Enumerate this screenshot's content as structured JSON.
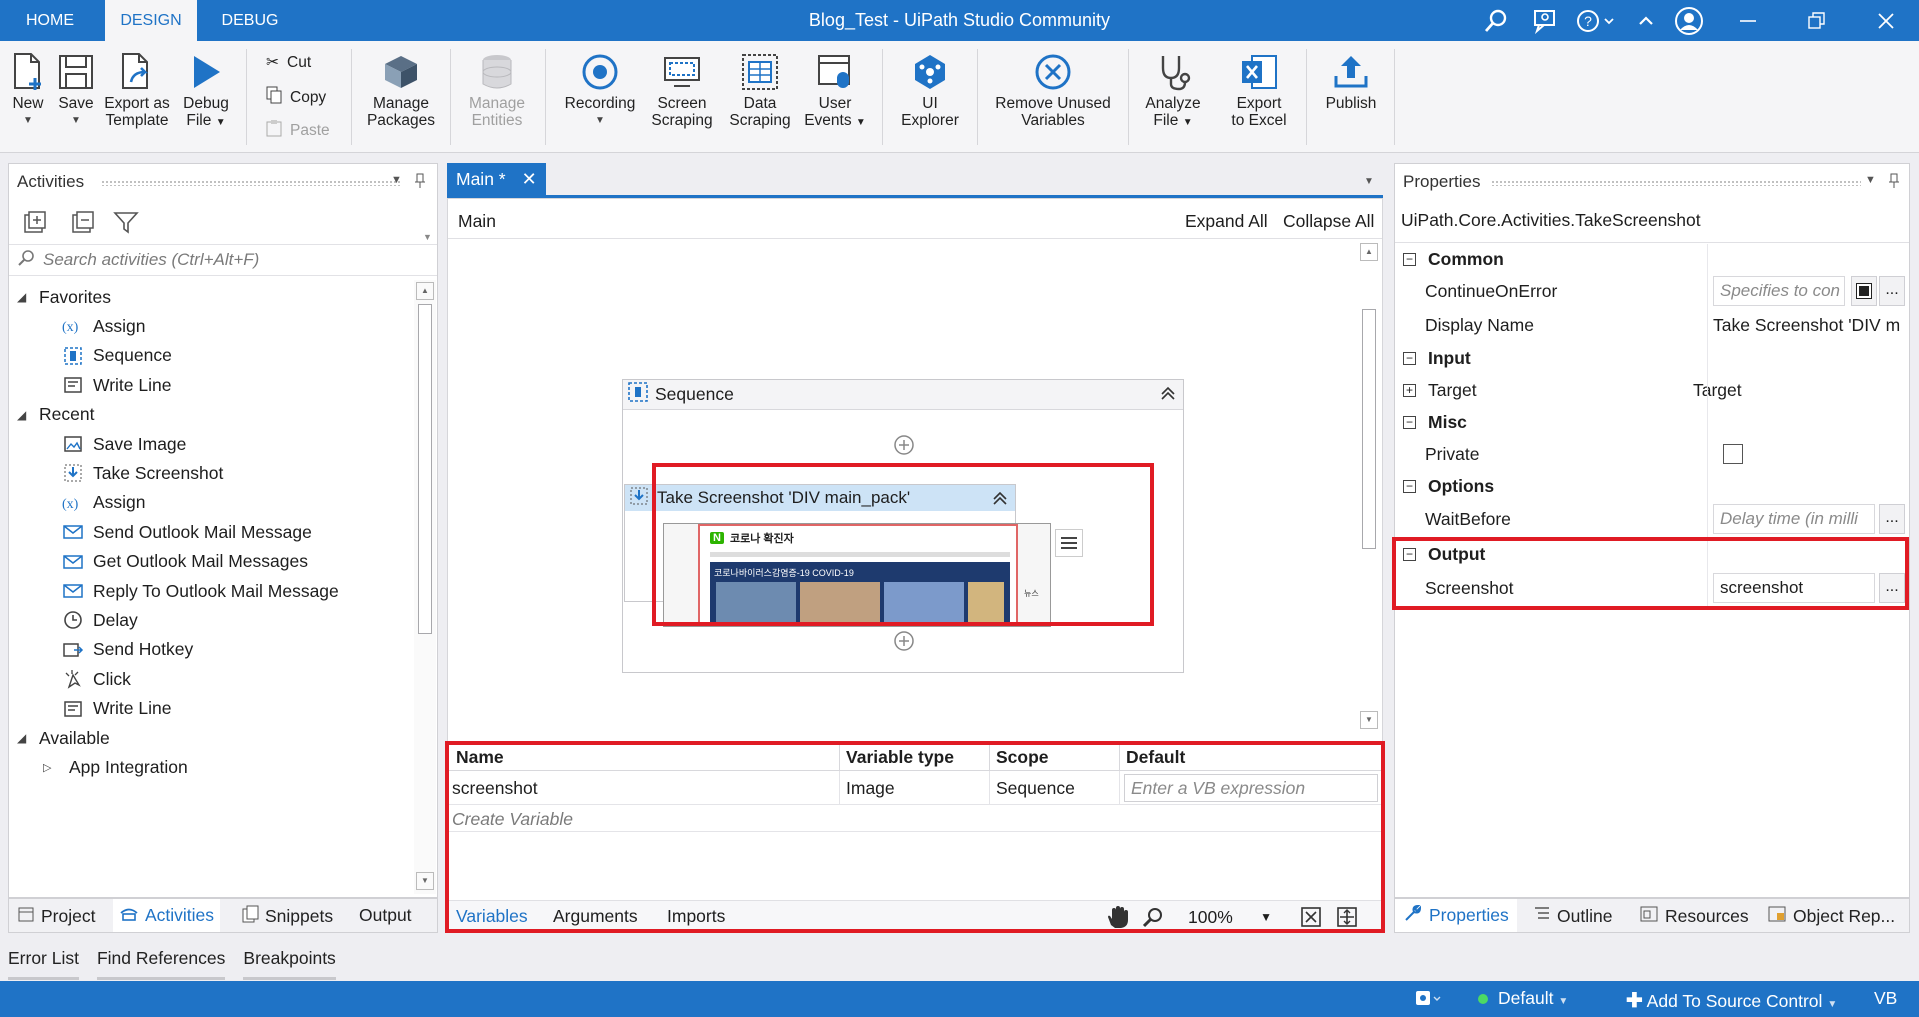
{
  "titlebar": {
    "tabs": [
      "HOME",
      "DESIGN",
      "DEBUG"
    ],
    "title": "Blog_Test - UiPath Studio Community"
  },
  "ribbon": {
    "new": "New",
    "save": "Save",
    "export_template": [
      "Export as",
      "Template"
    ],
    "debug_file": [
      "Debug",
      "File"
    ],
    "cut": "Cut",
    "copy": "Copy",
    "paste": "Paste",
    "manage_packages": [
      "Manage",
      "Packages"
    ],
    "manage_entities": [
      "Manage",
      "Entities"
    ],
    "recording": "Recording",
    "screen_scraping": [
      "Screen",
      "Scraping"
    ],
    "data_scraping": [
      "Data",
      "Scraping"
    ],
    "user_events": [
      "User",
      "Events"
    ],
    "ui_explorer": [
      "UI",
      "Explorer"
    ],
    "remove_unused": [
      "Remove Unused",
      "Variables"
    ],
    "analyze_file": [
      "Analyze",
      "File"
    ],
    "export_excel": [
      "Export",
      "to Excel"
    ],
    "publish": "Publish"
  },
  "activities": {
    "title": "Activities",
    "search_placeholder": "Search activities (Ctrl+Alt+F)",
    "favorites_label": "Favorites",
    "favorites": [
      {
        "label": "Assign",
        "icon": "assign-icon"
      },
      {
        "label": "Sequence",
        "icon": "sequence-icon"
      },
      {
        "label": "Write Line",
        "icon": "write-line-icon"
      }
    ],
    "recent_label": "Recent",
    "recent": [
      {
        "label": "Save Image",
        "icon": "save-image-icon"
      },
      {
        "label": "Take Screenshot",
        "icon": "take-screenshot-icon"
      },
      {
        "label": "Assign",
        "icon": "assign-icon"
      },
      {
        "label": "Send Outlook Mail Message",
        "icon": "mail-icon"
      },
      {
        "label": "Get Outlook Mail Messages",
        "icon": "mail-icon"
      },
      {
        "label": "Reply To Outlook Mail Message",
        "icon": "mail-icon"
      },
      {
        "label": "Delay",
        "icon": "clock-icon"
      },
      {
        "label": "Send Hotkey",
        "icon": "hotkey-icon"
      },
      {
        "label": "Click",
        "icon": "click-icon"
      },
      {
        "label": "Write Line",
        "icon": "write-line-icon"
      }
    ],
    "available_label": "Available",
    "app_integration": "App Integration"
  },
  "left_bottom_tabs": [
    "Project",
    "Activities",
    "Snippets",
    "Output"
  ],
  "bottom_tabs": [
    "Error List",
    "Find References",
    "Breakpoints"
  ],
  "designer": {
    "tab_label": "Main *",
    "breadcrumb": "Main",
    "expand_all": "Expand All",
    "collapse_all": "Collapse All",
    "sequence_title": "Sequence",
    "activity_title": "Take Screenshot 'DIV  main_pack'",
    "preview_heading": "코로나 확진자",
    "preview_banner": "코로나바이러스감염증-19 COVID-19"
  },
  "variables": {
    "headers": [
      "Name",
      "Variable type",
      "Scope",
      "Default"
    ],
    "rows": [
      {
        "name": "screenshot",
        "type": "Image",
        "scope": "Sequence",
        "default_placeholder": "Enter a VB expression"
      }
    ],
    "create": "Create Variable",
    "tabs": [
      "Variables",
      "Arguments",
      "Imports"
    ],
    "zoom": "100%"
  },
  "properties": {
    "title": "Properties",
    "class": "UiPath.Core.Activities.TakeScreenshot",
    "common": "Common",
    "continue_on_error": "ContinueOnError",
    "continue_placeholder": "Specifies to con",
    "display_name": "Display Name",
    "display_value": "Take Screenshot 'DIV  m",
    "input": "Input",
    "target": "Target",
    "target_value": "Target",
    "misc": "Misc",
    "private": "Private",
    "options": "Options",
    "wait_before": "WaitBefore",
    "wait_placeholder": "Delay time (in milli",
    "output": "Output",
    "screenshot": "Screenshot",
    "screenshot_value": "screenshot",
    "dots": "..."
  },
  "right_bottom_tabs": [
    "Properties",
    "Outline",
    "Resources",
    "Object Rep..."
  ],
  "statusbar": {
    "profile": "Default",
    "source_control": "Add To Source Control",
    "lang": "VB"
  },
  "colors": {
    "accent": "#1f73c6",
    "highlight": "#e01b24"
  }
}
